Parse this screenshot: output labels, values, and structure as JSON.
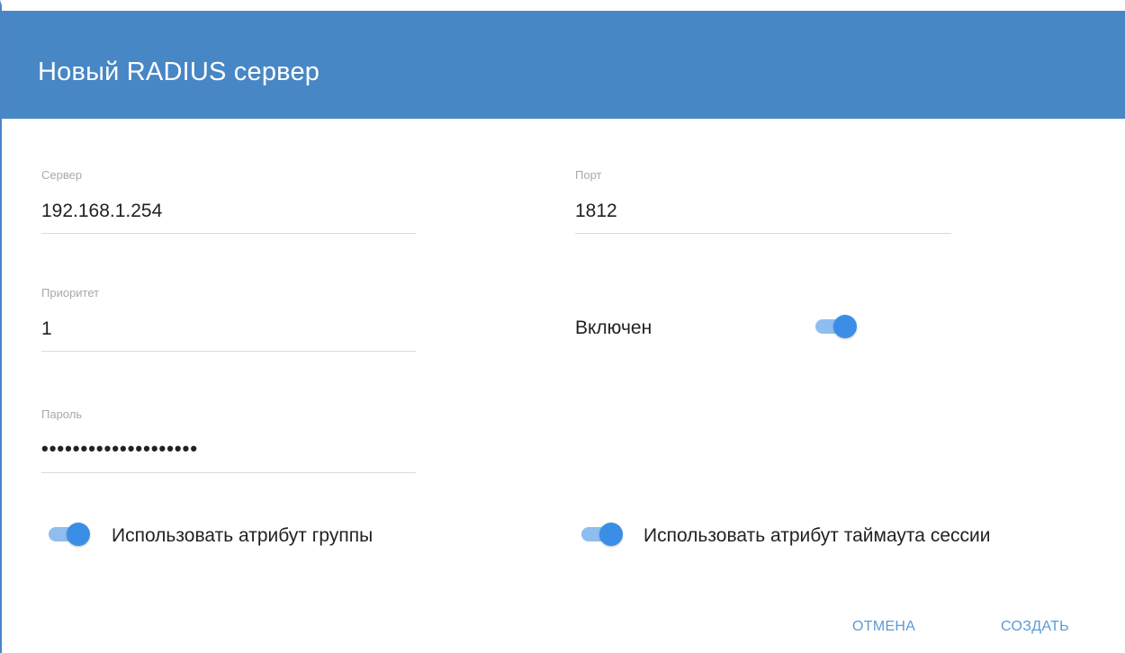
{
  "dialog": {
    "title": "Новый RADIUS сервер",
    "accent_color": "#4787c5"
  },
  "form": {
    "server": {
      "label": "Сервер",
      "value": "192.168.1.254"
    },
    "port": {
      "label": "Порт",
      "value": "1812"
    },
    "priority": {
      "label": "Приоритет",
      "value": "1"
    },
    "password": {
      "label": "Пароль",
      "value": "••••••••••••••••••••"
    },
    "enabled": {
      "label": "Включен",
      "checked": true
    },
    "use_group_attribute": {
      "label": "Использовать атрибут группы",
      "checked": true
    },
    "use_session_timeout_attribute": {
      "label": "Использовать атрибут таймаута сессии",
      "checked": true
    }
  },
  "actions": {
    "cancel_label": "ОТМЕНА",
    "create_label": "СОЗДАТЬ"
  }
}
